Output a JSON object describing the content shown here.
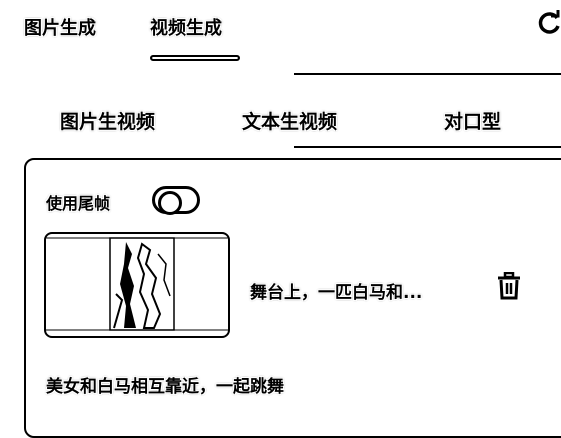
{
  "top_tabs": [
    {
      "label": "图片生成",
      "active": false
    },
    {
      "label": "视频生成",
      "active": true
    }
  ],
  "header_icons": {
    "refresh": "refresh-icon"
  },
  "sub_tabs": [
    {
      "label": "图片生视频",
      "active": true
    },
    {
      "label": "文本生视频",
      "active": false
    },
    {
      "label": "对口型",
      "active": false
    }
  ],
  "panel": {
    "use_tail_frame_label": "使用尾帧",
    "use_tail_frame_on": false,
    "item": {
      "prompt_preview": "舞台上，一匹白马和...",
      "delete_icon": "trash-icon"
    },
    "description": "美女和白马相互靠近，一起跳舞"
  }
}
